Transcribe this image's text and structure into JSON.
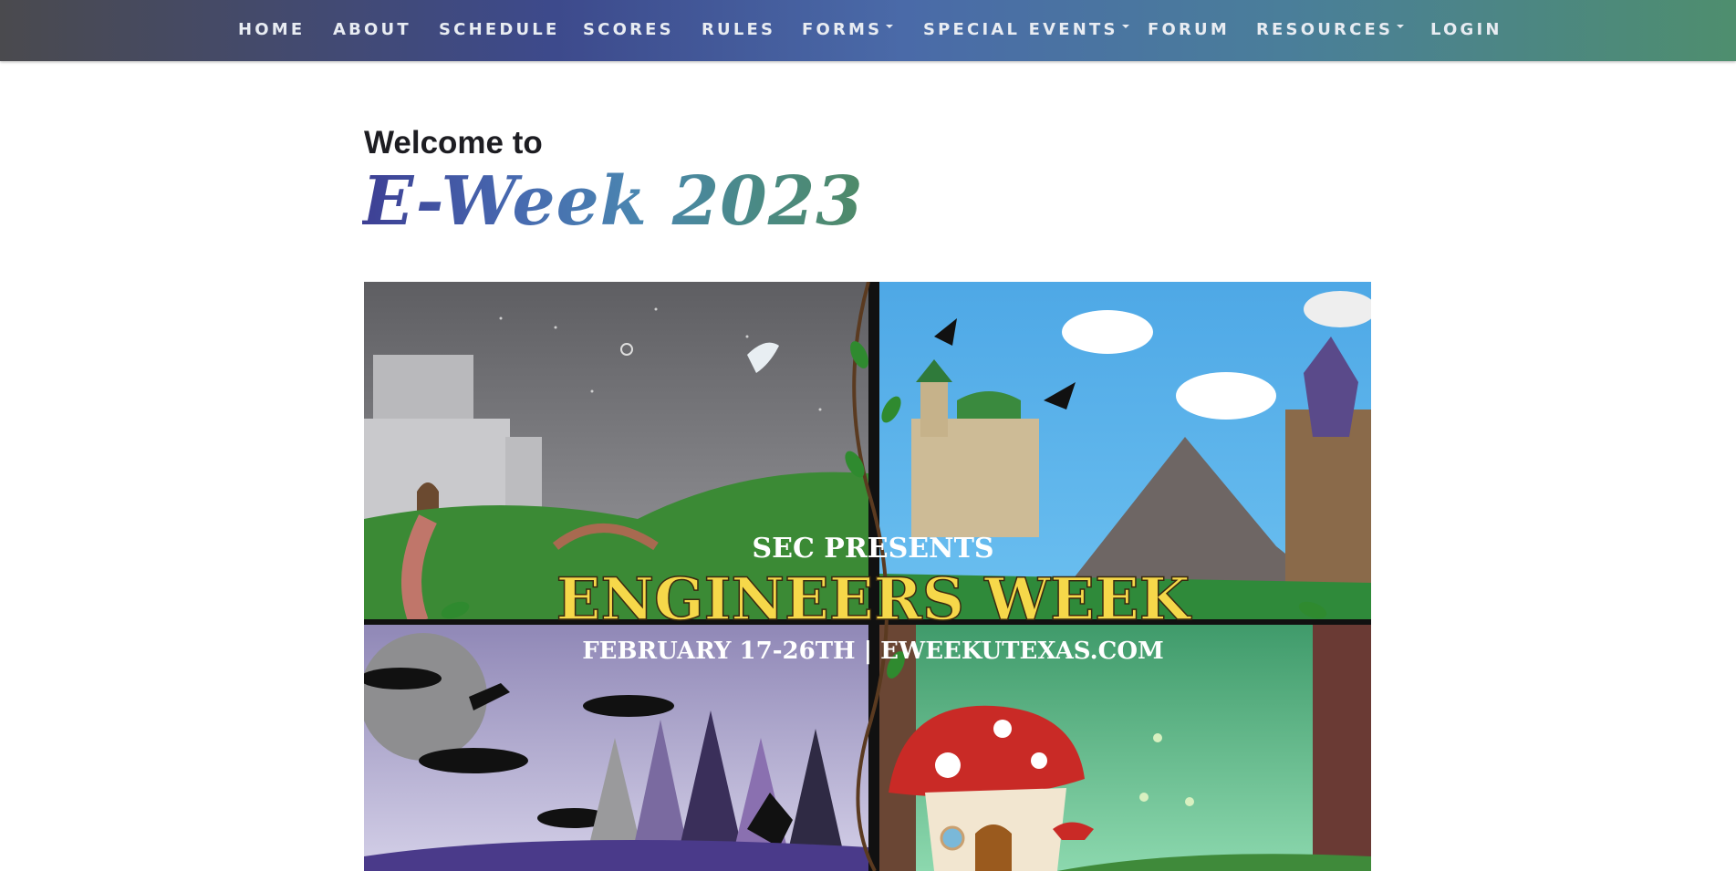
{
  "nav": {
    "items": [
      {
        "label": "HOME",
        "dropdown": false
      },
      {
        "label": "ABOUT",
        "dropdown": false
      },
      {
        "label": "SCHEDULE",
        "dropdown": false
      },
      {
        "label": "SCORES",
        "dropdown": false
      },
      {
        "label": "RULES",
        "dropdown": false
      },
      {
        "label": "FORMS",
        "dropdown": true
      },
      {
        "label": "SPECIAL EVENTS",
        "dropdown": true
      },
      {
        "label": "FORUM",
        "dropdown": false
      },
      {
        "label": "RESOURCES",
        "dropdown": true
      },
      {
        "label": "LOGIN",
        "dropdown": false
      }
    ]
  },
  "hero": {
    "welcome": "Welcome to",
    "title": "E-Week 2023"
  },
  "banner": {
    "line1": "SEC PRESENTS",
    "line2": "ENGINEERS WEEK",
    "line3": "FEBRUARY 17-26TH | EWEEKUTEXAS.COM"
  },
  "colors": {
    "nav_start": "#4a4a4e",
    "nav_mid": "#3d4a8c",
    "nav_end": "#4e8e6e",
    "banner_headline": "#f6d84a"
  }
}
